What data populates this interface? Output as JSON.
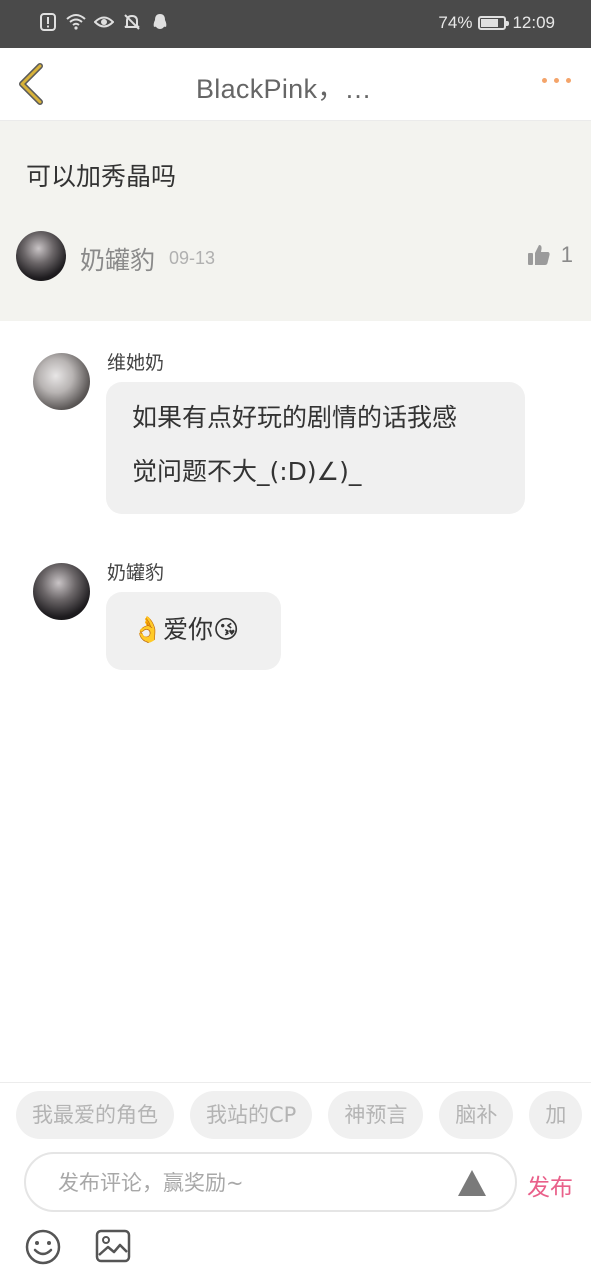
{
  "status_bar": {
    "battery_percent_text": "74%",
    "battery_level": 0.74,
    "time": "12:09",
    "icons": [
      "alert-icon",
      "wifi-icon",
      "eye-icon",
      "bell-off-icon",
      "qq-penguin-icon"
    ]
  },
  "header": {
    "title": "BlackPink，…",
    "back_icon": "chevron-left-icon",
    "more_icon": "more-dots-icon",
    "back_color": "#d8b23a",
    "more_color": "#f4a46a"
  },
  "post": {
    "text": "可以加秀晶吗",
    "author": "奶罐豹",
    "date": "09-13",
    "likes": "1"
  },
  "replies": [
    {
      "author": "维她奶",
      "text_lines": [
        "如果有点好玩的剧情的话我感",
        "觉问题不大_(:D)∠)_"
      ]
    },
    {
      "author": "奶罐豹",
      "text_lines": [
        "👌爱你😘"
      ]
    }
  ],
  "bottom": {
    "tags": [
      "我最爱的角色",
      "我站的CP",
      "神预言",
      "脑补",
      "加"
    ],
    "comment_placeholder": "发布评论，赢奖励~",
    "publish_label": "发布",
    "publish_color": "#e9608a"
  }
}
